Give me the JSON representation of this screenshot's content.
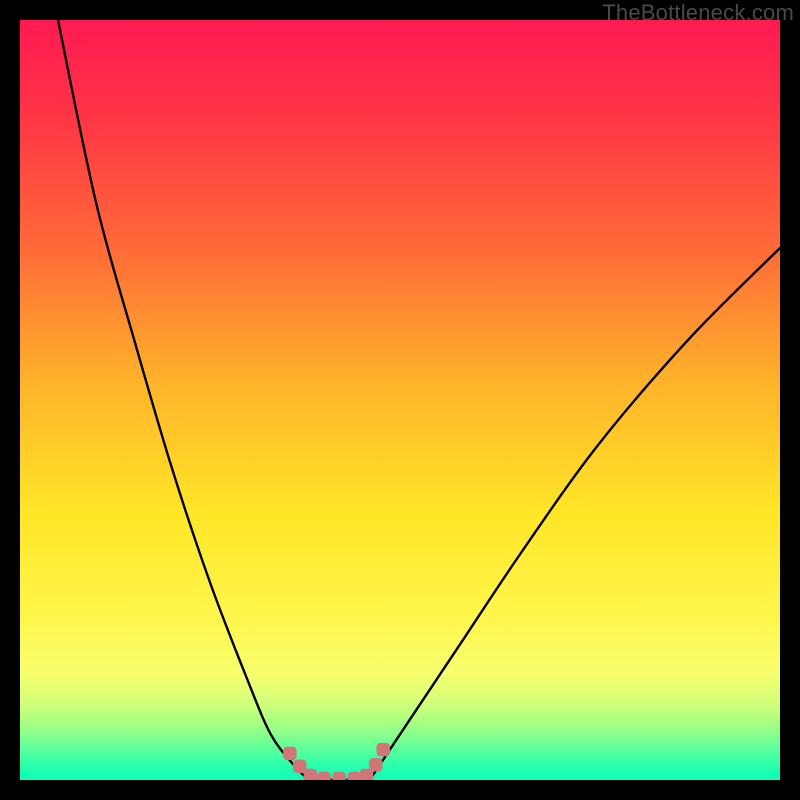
{
  "watermark": "TheBottleneck.com",
  "colors": {
    "frame_bg": "#000000",
    "gradient_top": "#ff1a52",
    "gradient_bottom": "#0affb9",
    "curve": "#000000",
    "marker": "#d17579"
  },
  "chart_data": {
    "type": "line",
    "title": "",
    "xlabel": "",
    "ylabel": "",
    "xlim": [
      0,
      100
    ],
    "ylim": [
      0,
      100
    ],
    "series": [
      {
        "name": "left-curve",
        "x": [
          5,
          10,
          15,
          20,
          25,
          30,
          33,
          36,
          38
        ],
        "y": [
          100,
          76,
          58,
          41,
          26,
          13,
          6,
          2,
          0
        ]
      },
      {
        "name": "right-curve",
        "x": [
          46,
          48,
          52,
          58,
          66,
          76,
          88,
          100
        ],
        "y": [
          0,
          3,
          9,
          18,
          30,
          44,
          58,
          70
        ]
      }
    ],
    "flat_segment": {
      "x": [
        38,
        46
      ],
      "y": [
        0,
        0
      ]
    },
    "markers": [
      {
        "x": 35.5,
        "y": 3.5
      },
      {
        "x": 36.8,
        "y": 1.8
      },
      {
        "x": 38.2,
        "y": 0.6
      },
      {
        "x": 40.0,
        "y": 0.2
      },
      {
        "x": 42.0,
        "y": 0.2
      },
      {
        "x": 44.0,
        "y": 0.2
      },
      {
        "x": 45.6,
        "y": 0.6
      },
      {
        "x": 46.8,
        "y": 2.0
      },
      {
        "x": 47.8,
        "y": 4.0
      }
    ]
  }
}
